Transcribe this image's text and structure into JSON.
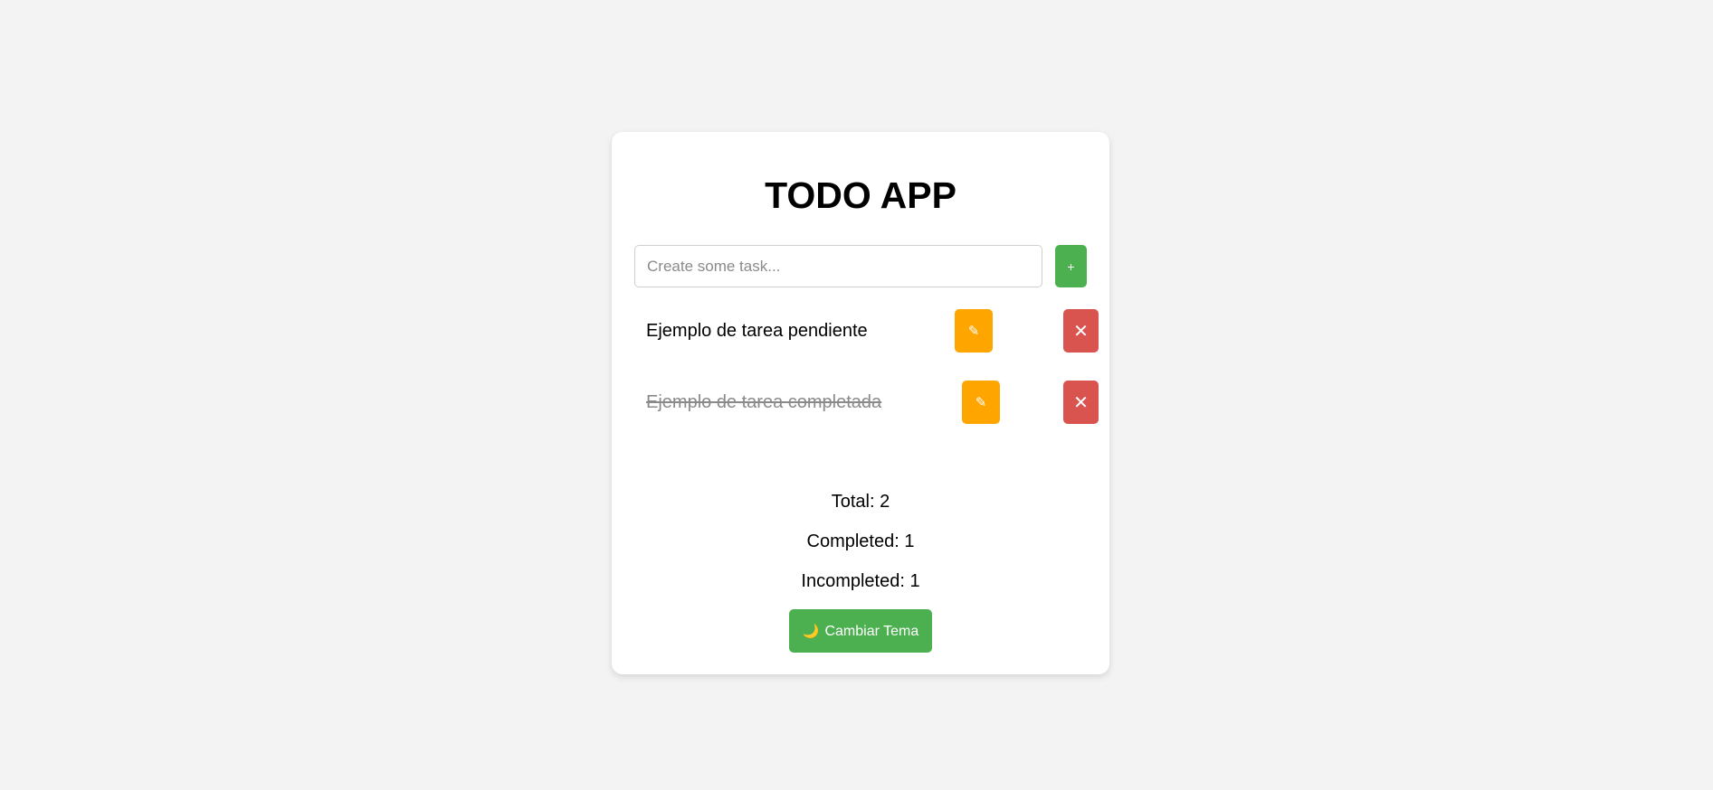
{
  "app": {
    "title": "TODO APP"
  },
  "input": {
    "placeholder": "Create some task...",
    "value": "",
    "add_label": "+"
  },
  "tasks": [
    {
      "text": "Ejemplo de tarea pendiente",
      "completed": false,
      "edit_icon": "pencil-icon",
      "edit_glyph": "✎",
      "delete_icon": "close-icon",
      "delete_glyph": "✕"
    },
    {
      "text": "Ejemplo de tarea completada",
      "completed": true,
      "edit_icon": "pencil-icon",
      "edit_glyph": "✎",
      "delete_icon": "close-icon",
      "delete_glyph": "✕"
    }
  ],
  "stats": {
    "total": "Total: 2",
    "completed": "Completed: 1",
    "incompleted": "Incompleted: 1"
  },
  "theme_button": {
    "icon": "moon-icon",
    "glyph": "🌙",
    "label": "Cambiar Tema"
  },
  "colors": {
    "page_background": "#f3f3f3",
    "card_background": "#ffffff",
    "primary_green": "#4caf50",
    "edit_orange": "#ffa500",
    "delete_red": "#d9534f",
    "completed_text": "#8a8a8a"
  }
}
